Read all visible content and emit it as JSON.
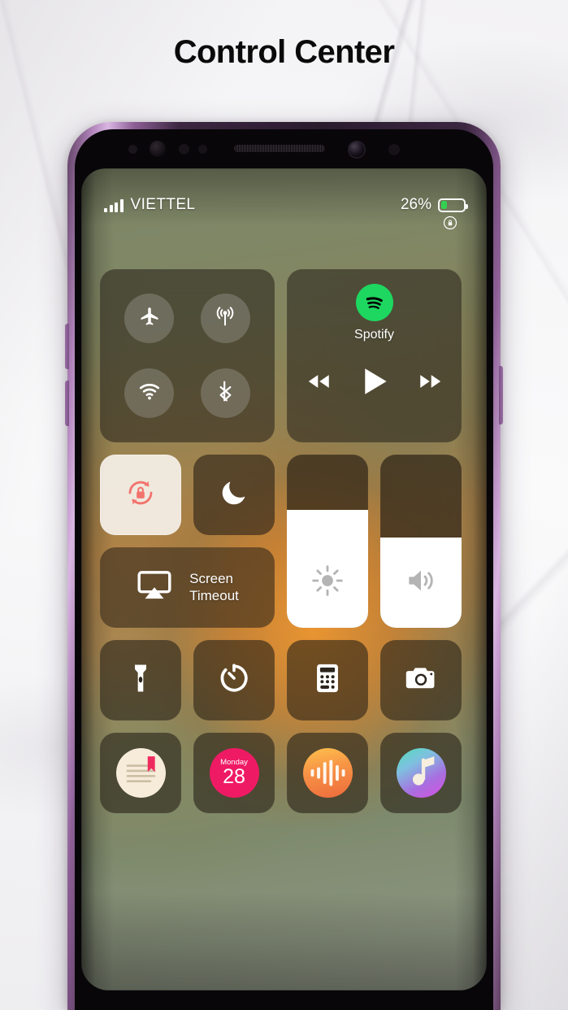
{
  "page": {
    "title": "Control Center"
  },
  "status_bar": {
    "carrier": "VIETTEL",
    "signal_bars": 4,
    "battery_percent_label": "26%",
    "battery_level": 26,
    "battery_color": "#33d14f",
    "rotation_lock_icon": "rotation-lock-icon"
  },
  "connectivity": {
    "buttons": [
      {
        "name": "airplane-mode",
        "icon": "airplane-icon",
        "active": false
      },
      {
        "name": "cellular-data",
        "icon": "cellular-antenna-icon",
        "active": false
      },
      {
        "name": "wifi",
        "icon": "wifi-icon",
        "active": false
      },
      {
        "name": "bluetooth",
        "icon": "bluetooth-icon",
        "active": false
      }
    ]
  },
  "media": {
    "app_name": "Spotify",
    "app_icon": "spotify-logo",
    "brand_color": "#1ed760",
    "controls": [
      {
        "name": "previous",
        "icon": "rewind-icon"
      },
      {
        "name": "play",
        "icon": "play-icon"
      },
      {
        "name": "next",
        "icon": "fast-forward-icon"
      }
    ]
  },
  "toggles": {
    "rotation_lock": {
      "label": "Rotation Lock",
      "icon": "rotation-lock-icon",
      "active": true,
      "accent_color": "#f2736e"
    },
    "do_not_disturb": {
      "label": "Do Not Disturb",
      "icon": "moon-icon",
      "active": false
    }
  },
  "screen_timeout": {
    "label_line1": "Screen",
    "label_line2": "Timeout",
    "icon": "airplay-screen-icon"
  },
  "sliders": [
    {
      "name": "brightness",
      "icon": "brightness-sun-icon",
      "value": 68
    },
    {
      "name": "volume",
      "icon": "volume-speaker-icon",
      "value": 52
    }
  ],
  "utilities": [
    {
      "name": "flashlight",
      "icon": "flashlight-icon"
    },
    {
      "name": "timer",
      "icon": "timer-icon"
    },
    {
      "name": "calculator",
      "icon": "calculator-icon"
    },
    {
      "name": "camera",
      "icon": "camera-icon"
    }
  ],
  "apps": [
    {
      "name": "notes",
      "icon": "notes-icon"
    },
    {
      "name": "calendar",
      "icon": "calendar-icon",
      "weekday": "Monday",
      "day": "28"
    },
    {
      "name": "recorder",
      "icon": "voice-recorder-icon"
    },
    {
      "name": "music",
      "icon": "music-note-icon"
    }
  ]
}
